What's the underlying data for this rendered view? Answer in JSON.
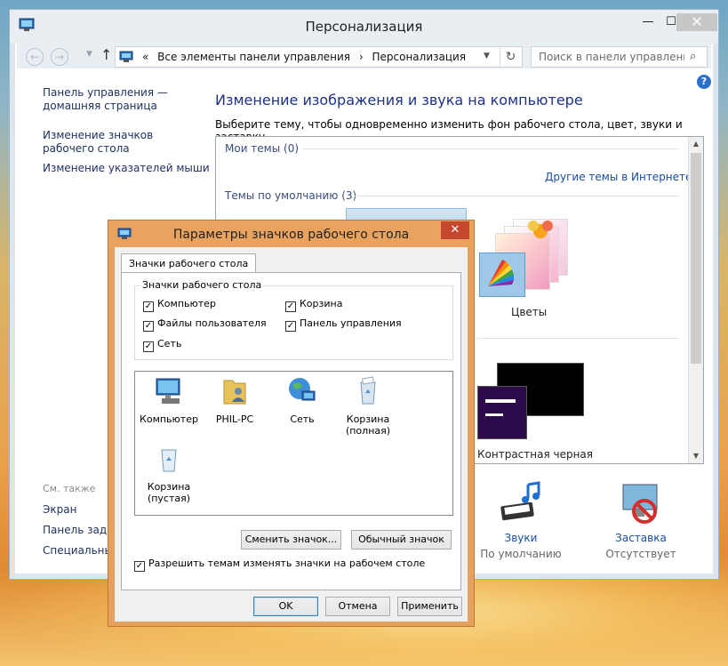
{
  "main_window": {
    "title": "Персонализация",
    "address": {
      "prefix": "«",
      "crumb1": "Все элементы панели управления",
      "separator": "›",
      "crumb2": "Персонализация"
    },
    "search_placeholder": "Поиск в панели управления",
    "sidebar": {
      "home_link": "Панель управления — домашняя страница",
      "links": [
        "Изменение значков рабочего стола",
        "Изменение указателей мыши"
      ],
      "see_also_title": "См. также",
      "see_also": [
        "Экран",
        "Панель задач",
        "Специальные"
      ]
    },
    "heading": "Изменение изображения и звука на компьютере",
    "description": "Выберите тему, чтобы одновременно изменить фон рабочего стола, цвет, звуки и заставку.",
    "themes": {
      "my_themes": "Мои темы (0)",
      "online_link": "Другие темы в Интернете",
      "default_themes": "Темы по умолчанию (3)",
      "theme_flowers": "Цветы",
      "theme_contrast_black": "Контрастная черная"
    },
    "bottom": [
      {
        "title": "Звуки",
        "value": "По умолчанию"
      },
      {
        "title": "Заставка",
        "value": "Отсутствует"
      }
    ]
  },
  "dialog": {
    "title": "Параметры значков рабочего стола",
    "tab": "Значки рабочего стола",
    "group_title": "Значки рабочего стола",
    "checkboxes": [
      {
        "label": "Компьютер",
        "checked": true
      },
      {
        "label": "Корзина",
        "checked": true
      },
      {
        "label": "Файлы пользователя",
        "checked": true
      },
      {
        "label": "Панель управления",
        "checked": true
      },
      {
        "label": "Сеть",
        "checked": true
      }
    ],
    "icons": [
      {
        "label": "Компьютер"
      },
      {
        "label": "PHIL-PC"
      },
      {
        "label": "Сеть"
      },
      {
        "label": "Корзина (полная)"
      },
      {
        "label": "Корзина (пустая)"
      }
    ],
    "change_icon": "Сменить значок...",
    "default_icon": "Обычный значок",
    "allow_themes": {
      "label": "Разрешить темам изменять значки на рабочем столе",
      "checked": true
    },
    "ok": "OK",
    "cancel": "Отмена",
    "apply": "Применить"
  }
}
